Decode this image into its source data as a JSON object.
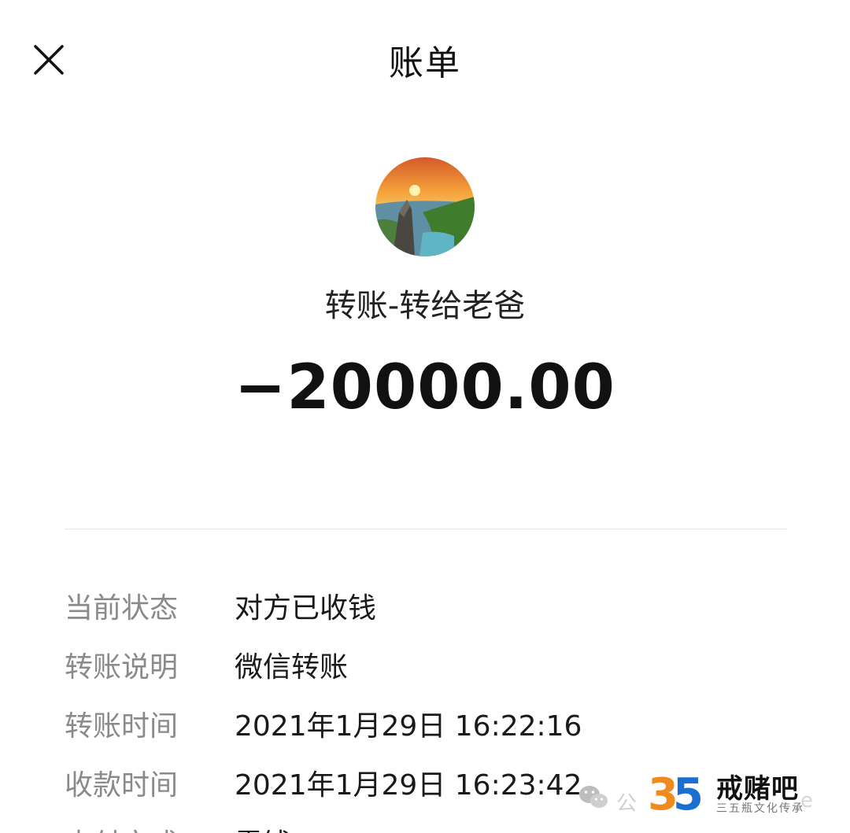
{
  "header": {
    "title": "账单",
    "close_icon": "close-icon"
  },
  "payee": {
    "avatar_icon": "sunset-landscape-avatar",
    "name": "转账-转给老爸"
  },
  "amount": "−20000.00",
  "details": [
    {
      "label": "当前状态",
      "value": "对方已收钱"
    },
    {
      "label": "转账说明",
      "value": "微信转账"
    },
    {
      "label": "转账时间",
      "value": "2021年1月29日 16:22:16"
    },
    {
      "label": "收款时间",
      "value": "2021年1月29日 16:23:42"
    },
    {
      "label": "支付方式",
      "value": "零钱"
    }
  ],
  "watermark": {
    "icon": "wechat-icon",
    "ghost_text": "公",
    "logo_text": "35",
    "brand": "戒赌吧",
    "subtitle": "三五瓶文化传承",
    "ghost_text_2": "e"
  },
  "colors": {
    "background": "#ffffff",
    "label": "#8a8a8a",
    "value": "#1a1a1a",
    "divider": "#e6e6e6",
    "logo_orange": "#f08a1c",
    "logo_blue": "#1a6fd1"
  }
}
